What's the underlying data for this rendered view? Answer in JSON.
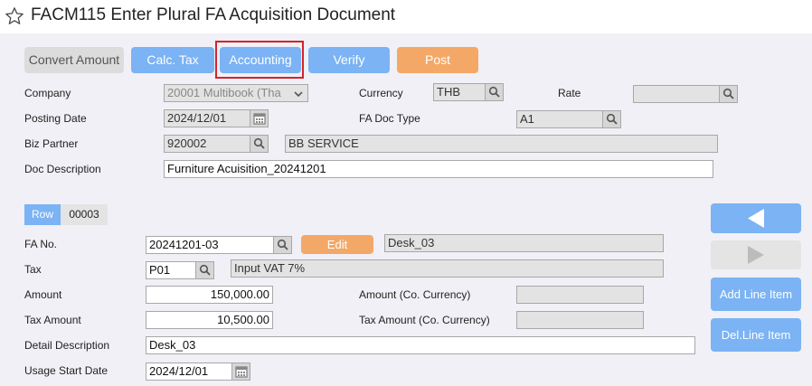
{
  "window": {
    "title": "FACM115 Enter Plural FA Acquisition Document"
  },
  "toolbar": {
    "convert_amount": "Convert Amount",
    "calc_tax": "Calc. Tax",
    "accounting": "Accounting",
    "verify": "Verify",
    "post": "Post"
  },
  "header": {
    "company_label": "Company",
    "company_value": "20001 Multibook (Tha",
    "currency_label": "Currency",
    "currency_value": "THB",
    "rate_label": "Rate",
    "rate_value": "",
    "posting_date_label": "Posting Date",
    "posting_date_value": "2024/12/01",
    "fa_doc_type_label": "FA Doc Type",
    "fa_doc_type_value": "A1",
    "biz_partner_label": "Biz Partner",
    "biz_partner_code": "920002",
    "biz_partner_name": "BB SERVICE",
    "doc_description_label": "Doc Description",
    "doc_description_value": "Furniture Acuisition_20241201"
  },
  "line": {
    "row_label": "Row",
    "row_number": "00003",
    "fa_no_label": "FA No.",
    "fa_no_value": "20241201-03",
    "edit_label": "Edit",
    "fa_name": "Desk_03",
    "tax_label": "Tax",
    "tax_code": "P01",
    "tax_name": "Input VAT 7%",
    "amount_label": "Amount",
    "amount_value": "150,000.00",
    "amount_co_label": "Amount (Co. Currency)",
    "amount_co_value": "",
    "tax_amount_label": "Tax Amount",
    "tax_amount_value": "10,500.00",
    "tax_amount_co_label": "Tax Amount (Co. Currency)",
    "tax_amount_co_value": "",
    "detail_description_label": "Detail Description",
    "detail_description_value": "Desk_03",
    "usage_start_date_label": "Usage Start Date",
    "usage_start_date_value": "2024/12/01"
  },
  "side": {
    "prev_icon": "triangle-left-icon",
    "next_icon": "triangle-right-icon",
    "add_line_item": "Add Line Item",
    "del_line_item": "Del.Line Item"
  },
  "colors": {
    "accent_blue": "#7bb3f4",
    "accent_orange": "#f4a867",
    "highlight_red": "#d5232a",
    "panel_bg": "#f0f0f6"
  }
}
